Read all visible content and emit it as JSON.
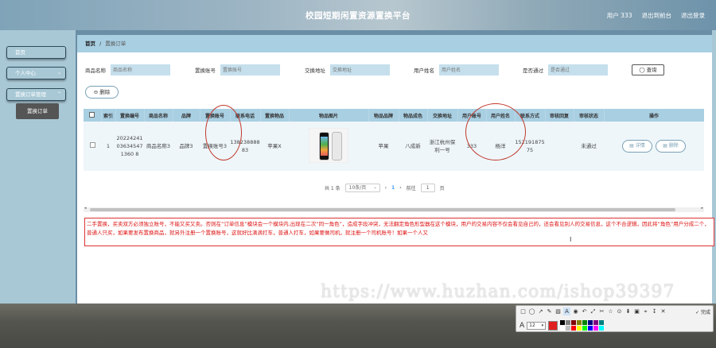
{
  "header": {
    "title": "校园短期闲置资源置换平台",
    "user_label": "用户 333",
    "back_label": "退出到前台",
    "logout_label": "退出登录"
  },
  "sidebar": {
    "home": "首页",
    "personal": "个人中心",
    "order_mgmt": "置换订单管理",
    "order_sub": "置换订单"
  },
  "breadcrumb": {
    "home": "首页",
    "current": "置换订单"
  },
  "search": {
    "fields": [
      {
        "label": "商品名称",
        "placeholder": "商品名称"
      },
      {
        "label": "置换账号",
        "placeholder": "置换账号"
      },
      {
        "label": "交换地址",
        "placeholder": "交换地址"
      },
      {
        "label": "用户姓名",
        "placeholder": "用户姓名"
      },
      {
        "label": "是否通过",
        "placeholder": "是否通过"
      }
    ],
    "query_label": "◯ 查询"
  },
  "delete_label": "⊖ 删除",
  "table": {
    "headers": [
      "",
      "索引",
      "置换编号",
      "商品名称",
      "品牌",
      "置换账号",
      "联系电话",
      "置换物品",
      "物品图片",
      "物品品牌",
      "物品成色",
      "交换地址",
      "用户账号",
      "用户姓名",
      "联系方式",
      "审核回复",
      "审核状态",
      "操作"
    ],
    "row": {
      "index": "1",
      "number": "20224241036345471360 8",
      "product_name": "商品名称3",
      "brand": "品牌3",
      "swap_account": "置换账号3",
      "phone": "13823888883",
      "swap_item": "苹果X",
      "image_icon": "iphone-product-photo",
      "item_brand": "苹果",
      "condition": "八成新",
      "address": "浙江杭州保利一号",
      "user_account": "333",
      "user_name": "杨洋",
      "contact": "15219187575",
      "reply": "",
      "status": "未通过",
      "detail_label": "▤ 详情",
      "delete_label": "▤ 删除"
    }
  },
  "pager": {
    "total": "共 1 条",
    "page_size": "10条/页",
    "prev": "‹",
    "current": "1",
    "next": "›",
    "goto_label": "前往",
    "goto_value": "1",
    "page_unit": "页"
  },
  "note": {
    "text": "二手置换，买卖双方必须独立账号，不能又买又卖。否则在“订单信息”模块会一个模块内,出现在二次“同一角色”，造成字段冲突，无法翻定角色形型器在这个模块，用户的交易内容不仅会看见自己的，还会看见别人的交易信息，这个不合逻辑，因此将“角色”用户分成二个，普通人只买，如果要发布置换商品，就另外注册一个置换账号，这就好比滴滴打车，普通人打车，如果要做司机，就注册一个司机账号！如果一个人又"
  },
  "watermark": "https://www.huzhan.com/ishop39397",
  "toolbar": {
    "tools": [
      "□",
      "◯",
      "↗",
      "✎",
      "▧",
      "A",
      "◉",
      "↶",
      "⤢",
      "✂",
      "☆",
      "⊙",
      "⬇",
      "▣",
      "⌖",
      "↧"
    ],
    "cancel": "✕",
    "done_label": "✓ 完成",
    "font_icon": "A",
    "font_size": "12",
    "current_color": "#e02020",
    "palette": [
      "#000000",
      "#808080",
      "#800000",
      "#808000",
      "#008000",
      "#000080",
      "#800080",
      "#008080",
      "#ffffff",
      "#c0c0c0",
      "#ff0000",
      "#ffff00",
      "#00ff00",
      "#0000ff",
      "#ff00ff",
      "#00ffff"
    ]
  }
}
